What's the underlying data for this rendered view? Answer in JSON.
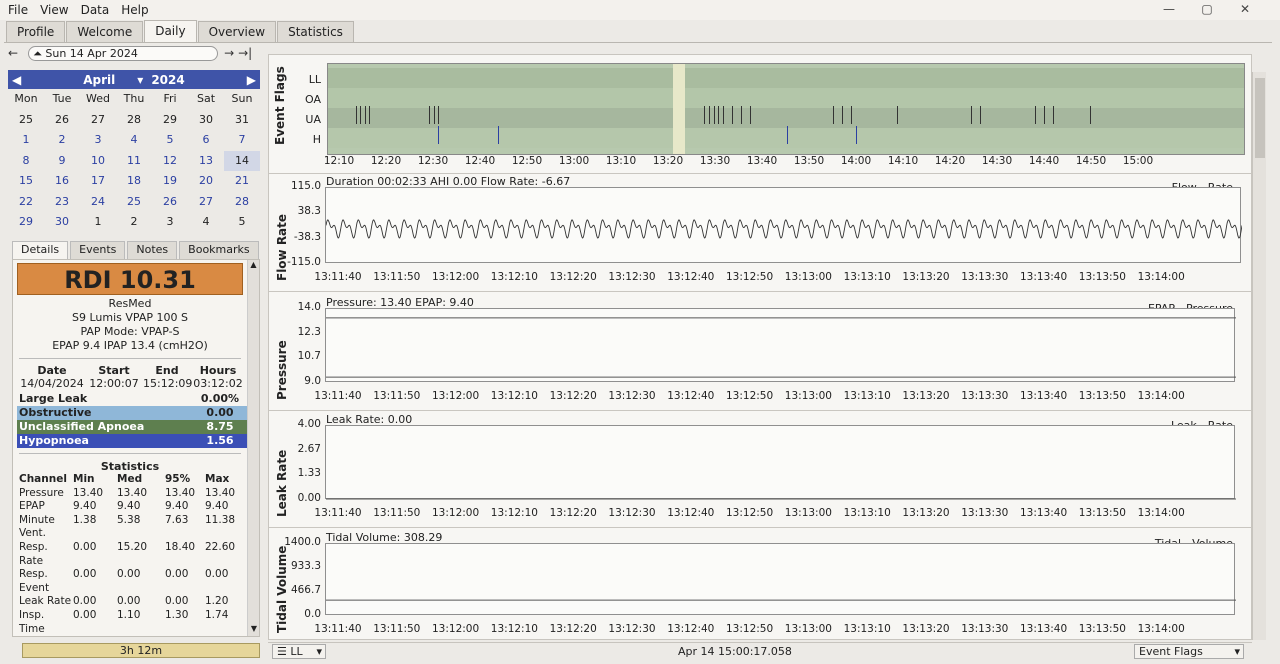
{
  "menu": [
    "File",
    "View",
    "Data",
    "Help"
  ],
  "tabs": [
    "Profile",
    "Welcome",
    "Daily",
    "Overview",
    "Statistics"
  ],
  "active_tab": "Daily",
  "date_nav": {
    "date": "Sun 14 Apr 2024",
    "prev": "←",
    "next": "→",
    "last": "→|"
  },
  "calendar": {
    "month": "April",
    "year": "2024",
    "weekdays": [
      "Mon",
      "Tue",
      "Wed",
      "Thu",
      "Fri",
      "Sat",
      "Sun"
    ],
    "days": [
      [
        "25",
        "26",
        "27",
        "28",
        "29",
        "30",
        "31"
      ],
      [
        "1",
        "2",
        "3",
        "4",
        "5",
        "6",
        "7"
      ],
      [
        "8",
        "9",
        "10",
        "11",
        "12",
        "13",
        "14"
      ],
      [
        "15",
        "16",
        "17",
        "18",
        "19",
        "20",
        "21"
      ],
      [
        "22",
        "23",
        "24",
        "25",
        "26",
        "27",
        "28"
      ],
      [
        "29",
        "30",
        "1",
        "2",
        "3",
        "4",
        "5"
      ]
    ],
    "selected": "14"
  },
  "left_tabs": [
    "Details",
    "Events",
    "Notes",
    "Bookmarks"
  ],
  "details": {
    "rdi": "RDI 10.31",
    "brand": "ResMed",
    "model": "S9 Lumis VPAP 100 S",
    "mode": "PAP Mode: VPAP-S",
    "settings": "EPAP 9.4 IPAP 13.4 (cmH2O)",
    "session_headers": [
      "Date",
      "Start",
      "End",
      "Hours"
    ],
    "session_values": [
      "14/04/2024",
      "12:00:07",
      "15:12:09",
      "03:12:02"
    ],
    "events": [
      {
        "name": "Large Leak",
        "value": "0.00%",
        "color": "#f6f4f0"
      },
      {
        "name": "Obstructive",
        "value": "0.00",
        "color": "#8fb7d8"
      },
      {
        "name": "Unclassified Apnoea",
        "value": "8.75",
        "color": "#5e7f4f"
      },
      {
        "name": "Hypopnoea",
        "value": "1.56",
        "color": "#3b4fb6"
      }
    ],
    "stats_title": "Statistics",
    "stats_headers": [
      "Channel",
      "Min",
      "Med",
      "95%",
      "Max"
    ],
    "stats_rows": [
      [
        "Pressure",
        "13.40",
        "13.40",
        "13.40",
        "13.40"
      ],
      [
        "EPAP",
        "9.40",
        "9.40",
        "9.40",
        "9.40"
      ],
      [
        "Minute",
        "1.38",
        "5.38",
        "7.63",
        "11.38"
      ],
      [
        "Vent.",
        "",
        "",
        "",
        ""
      ],
      [
        "Resp.",
        "0.00",
        "15.20",
        "18.40",
        "22.60"
      ],
      [
        "Rate",
        "",
        "",
        "",
        ""
      ],
      [
        "Resp.",
        "0.00",
        "0.00",
        "0.00",
        "0.00"
      ],
      [
        "Event",
        "",
        "",
        "",
        ""
      ],
      [
        "Leak Rate",
        "0.00",
        "0.00",
        "0.00",
        "1.20"
      ],
      [
        "Insp.",
        "0.00",
        "1.10",
        "1.30",
        "1.74"
      ],
      [
        "Time",
        "",
        "",
        "",
        ""
      ]
    ],
    "duration": "3h 12m"
  },
  "event_flags": {
    "label": "Event Flags",
    "rows": [
      "LL",
      "OA",
      "UA",
      "H"
    ],
    "x_ticks": [
      "12:10",
      "12:20",
      "12:30",
      "12:40",
      "12:50",
      "13:00",
      "13:10",
      "13:20",
      "13:30",
      "13:40",
      "13:50",
      "14:00",
      "14:10",
      "14:20",
      "14:30",
      "14:40",
      "14:50",
      "15:00"
    ],
    "ua_events": [
      0.03,
      0.035,
      0.04,
      0.045,
      0.11,
      0.115,
      0.12,
      0.41,
      0.415,
      0.42,
      0.425,
      0.43,
      0.44,
      0.45,
      0.46,
      0.55,
      0.56,
      0.57,
      0.62,
      0.7,
      0.71,
      0.77,
      0.78,
      0.79,
      0.83
    ],
    "h_events": [
      0.12,
      0.185,
      0.5,
      0.575
    ]
  },
  "chart_data": [
    {
      "type": "line",
      "title": "Duration 00:02:33 AHI 0.00 Flow Rate: -6.67",
      "ylabel": "Flow Rate",
      "legend": "Flow Rate",
      "yticks": [
        "115.0",
        "38.3",
        "-38.3",
        "-115.0"
      ],
      "ylim": [
        -115,
        115
      ],
      "xticks": [
        "13:11:40",
        "13:11:50",
        "13:12:00",
        "13:12:10",
        "13:12:20",
        "13:12:30",
        "13:12:40",
        "13:12:50",
        "13:13:00",
        "13:13:10",
        "13:13:20",
        "13:13:30",
        "13:13:40",
        "13:13:50",
        "13:14:00"
      ]
    },
    {
      "type": "line",
      "title": "Pressure: 13.40 EPAP: 9.40",
      "ylabel": "Pressure",
      "legend": "EPAP Pressure",
      "yticks": [
        "14.0",
        "12.3",
        "10.7",
        "9.0"
      ],
      "ylim": [
        9,
        14
      ],
      "series": [
        {
          "name": "Pressure",
          "value": 13.4
        },
        {
          "name": "EPAP",
          "value": 9.4
        }
      ],
      "xticks": [
        "13:11:40",
        "13:11:50",
        "13:12:00",
        "13:12:10",
        "13:12:20",
        "13:12:30",
        "13:12:40",
        "13:12:50",
        "13:13:00",
        "13:13:10",
        "13:13:20",
        "13:13:30",
        "13:13:40",
        "13:13:50",
        "13:14:00"
      ]
    },
    {
      "type": "line",
      "title": "Leak Rate: 0.00",
      "ylabel": "Leak Rate",
      "legend": "Leak Rate",
      "yticks": [
        "4.00",
        "2.67",
        "1.33",
        "0.00"
      ],
      "ylim": [
        0,
        4
      ],
      "series": [
        {
          "name": "Leak Rate",
          "value": 0
        }
      ],
      "xticks": [
        "13:11:40",
        "13:11:50",
        "13:12:00",
        "13:12:10",
        "13:12:20",
        "13:12:30",
        "13:12:40",
        "13:12:50",
        "13:13:00",
        "13:13:10",
        "13:13:20",
        "13:13:30",
        "13:13:40",
        "13:13:50",
        "13:14:00"
      ]
    },
    {
      "type": "line",
      "title": "Tidal Volume: 308.29",
      "ylabel": "Tidal Volume",
      "legend": "Tidal Volume",
      "yticks": [
        "1400.0",
        "933.3",
        "466.7",
        "0.0"
      ],
      "ylim": [
        0,
        1400
      ],
      "series": [
        {
          "name": "Tidal Volume",
          "value": 308.29
        }
      ],
      "xticks": [
        "13:11:40",
        "13:11:50",
        "13:12:00",
        "13:12:10",
        "13:12:20",
        "13:12:30",
        "13:12:40",
        "13:12:50",
        "13:13:00",
        "13:13:10",
        "13:13:20",
        "13:13:30",
        "13:13:40",
        "13:13:50",
        "13:14:00"
      ]
    }
  ],
  "status": {
    "left": "LL",
    "center": "Apr 14 15:00:17.058",
    "right": "Event Flags"
  },
  "window_controls": [
    "—",
    "▢",
    "✕"
  ]
}
